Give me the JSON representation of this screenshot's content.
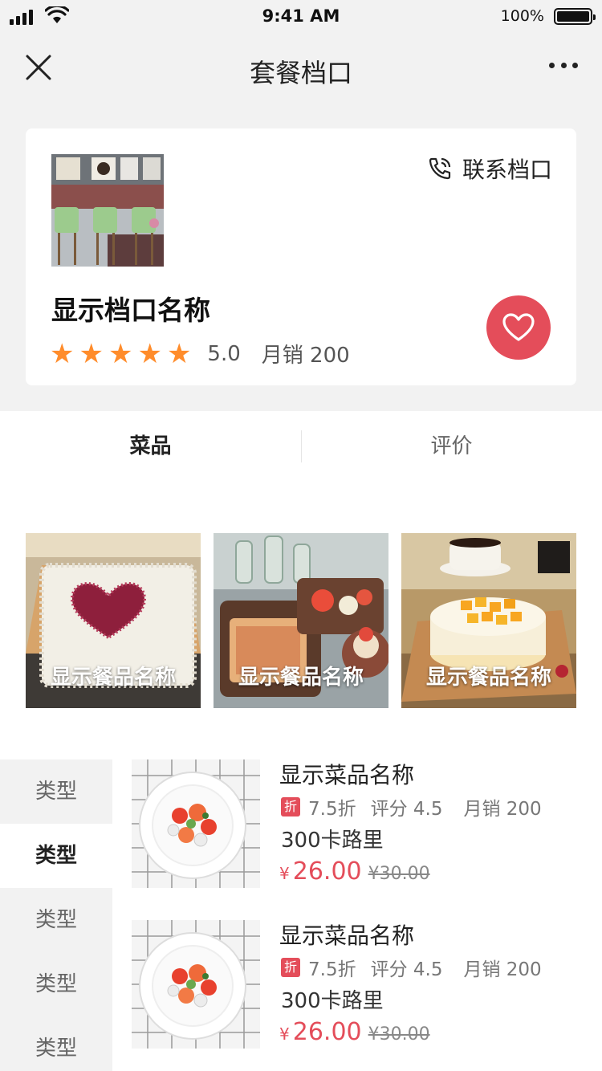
{
  "status_bar": {
    "time": "9:41 AM",
    "battery": "100%"
  },
  "nav": {
    "title": "套餐档口"
  },
  "store": {
    "contact_label": "联系档口",
    "name": "显示档口名称",
    "rating": "5.0",
    "monthly_sales": "月销 200",
    "stars": 5,
    "star_color": "#ff8c2b",
    "fav_color": "#e44d5a"
  },
  "tabs": [
    {
      "label": "菜品",
      "active": true
    },
    {
      "label": "评价",
      "active": false
    }
  ],
  "featured": [
    {
      "name": "显示餐品名称"
    },
    {
      "name": "显示餐品名称"
    },
    {
      "name": "显示餐品名称"
    }
  ],
  "categories": [
    {
      "label": "类型",
      "active": false
    },
    {
      "label": "类型",
      "active": true
    },
    {
      "label": "类型",
      "active": false
    },
    {
      "label": "类型",
      "active": false
    },
    {
      "label": "类型",
      "active": false
    }
  ],
  "dishes": [
    {
      "name": "显示菜品名称",
      "discount_badge": "折",
      "discount": "7.5折",
      "score": "评分 4.5",
      "sales": "月销 200",
      "calories": "300卡路里",
      "currency": "¥",
      "price": "26.00",
      "original_price": "¥30.00"
    },
    {
      "name": "显示菜品名称",
      "discount_badge": "折",
      "discount": "7.5折",
      "score": "评分 4.5",
      "sales": "月销 200",
      "calories": "300卡路里",
      "currency": "¥",
      "price": "26.00",
      "original_price": "¥30.00"
    }
  ]
}
